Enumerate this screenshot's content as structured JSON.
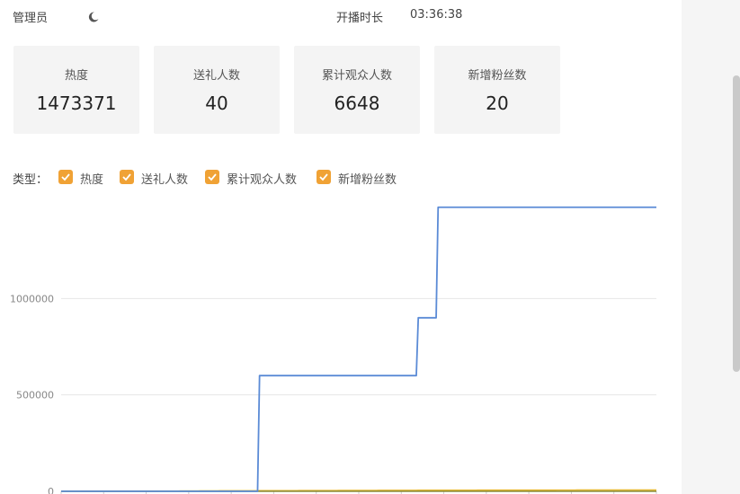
{
  "header": {
    "admin_label": "管理员",
    "moon_icon": "moon-icon",
    "live_duration_label": "开播时长",
    "live_duration_value": "03:36:38"
  },
  "stats": [
    {
      "label": "热度",
      "value": "1473371"
    },
    {
      "label": "送礼人数",
      "value": "40"
    },
    {
      "label": "累计观众人数",
      "value": "6648"
    },
    {
      "label": "新增粉丝数",
      "value": "20"
    }
  ],
  "filter": {
    "title": "类型：",
    "items": [
      {
        "label": "热度",
        "checked": true
      },
      {
        "label": "送礼人数",
        "checked": true
      },
      {
        "label": "累计观众人数",
        "checked": true
      },
      {
        "label": "新增粉丝数",
        "checked": true
      }
    ],
    "checkbox_color": "#f0a235"
  },
  "chart_data": {
    "type": "line",
    "y_ticks": [
      "1000000",
      "500000",
      "0"
    ],
    "ylim": [
      0,
      1500000
    ],
    "grid": true,
    "x": [
      0,
      1,
      2,
      3,
      4,
      5,
      6,
      7,
      8,
      9,
      10,
      11,
      12,
      13,
      14,
      15,
      16,
      17,
      18,
      19,
      20,
      21,
      22,
      23,
      24,
      25,
      26,
      27,
      28,
      29,
      30
    ],
    "series": [
      {
        "color": "#5b8bd6",
        "values": [
          0,
          0,
          0,
          0,
          0,
          0,
          0,
          0,
          0,
          0,
          600000,
          600000,
          600000,
          600000,
          600000,
          600000,
          600000,
          600000,
          900000,
          1473371,
          1473371,
          1473371,
          1473371,
          1473371,
          1473371,
          1473371,
          1473371,
          1473371,
          1473371,
          1473371,
          1473371
        ]
      },
      {
        "color": "#e6b832",
        "values": [
          0,
          100,
          300,
          600,
          900,
          1200,
          1600,
          2000,
          2400,
          2800,
          3200,
          3500,
          3800,
          4100,
          4400,
          4700,
          5000,
          5200,
          5400,
          5600,
          5800,
          5950,
          6100,
          6200,
          6300,
          6400,
          6480,
          6550,
          6600,
          6630,
          6648
        ]
      },
      {
        "color": "#8a8a3a",
        "values": [
          0,
          0,
          0,
          0,
          0,
          0,
          0,
          0,
          0,
          0,
          10,
          12,
          14,
          16,
          18,
          20,
          22,
          24,
          26,
          28,
          30,
          32,
          34,
          35,
          36,
          37,
          38,
          39,
          40,
          40,
          40
        ]
      }
    ]
  }
}
